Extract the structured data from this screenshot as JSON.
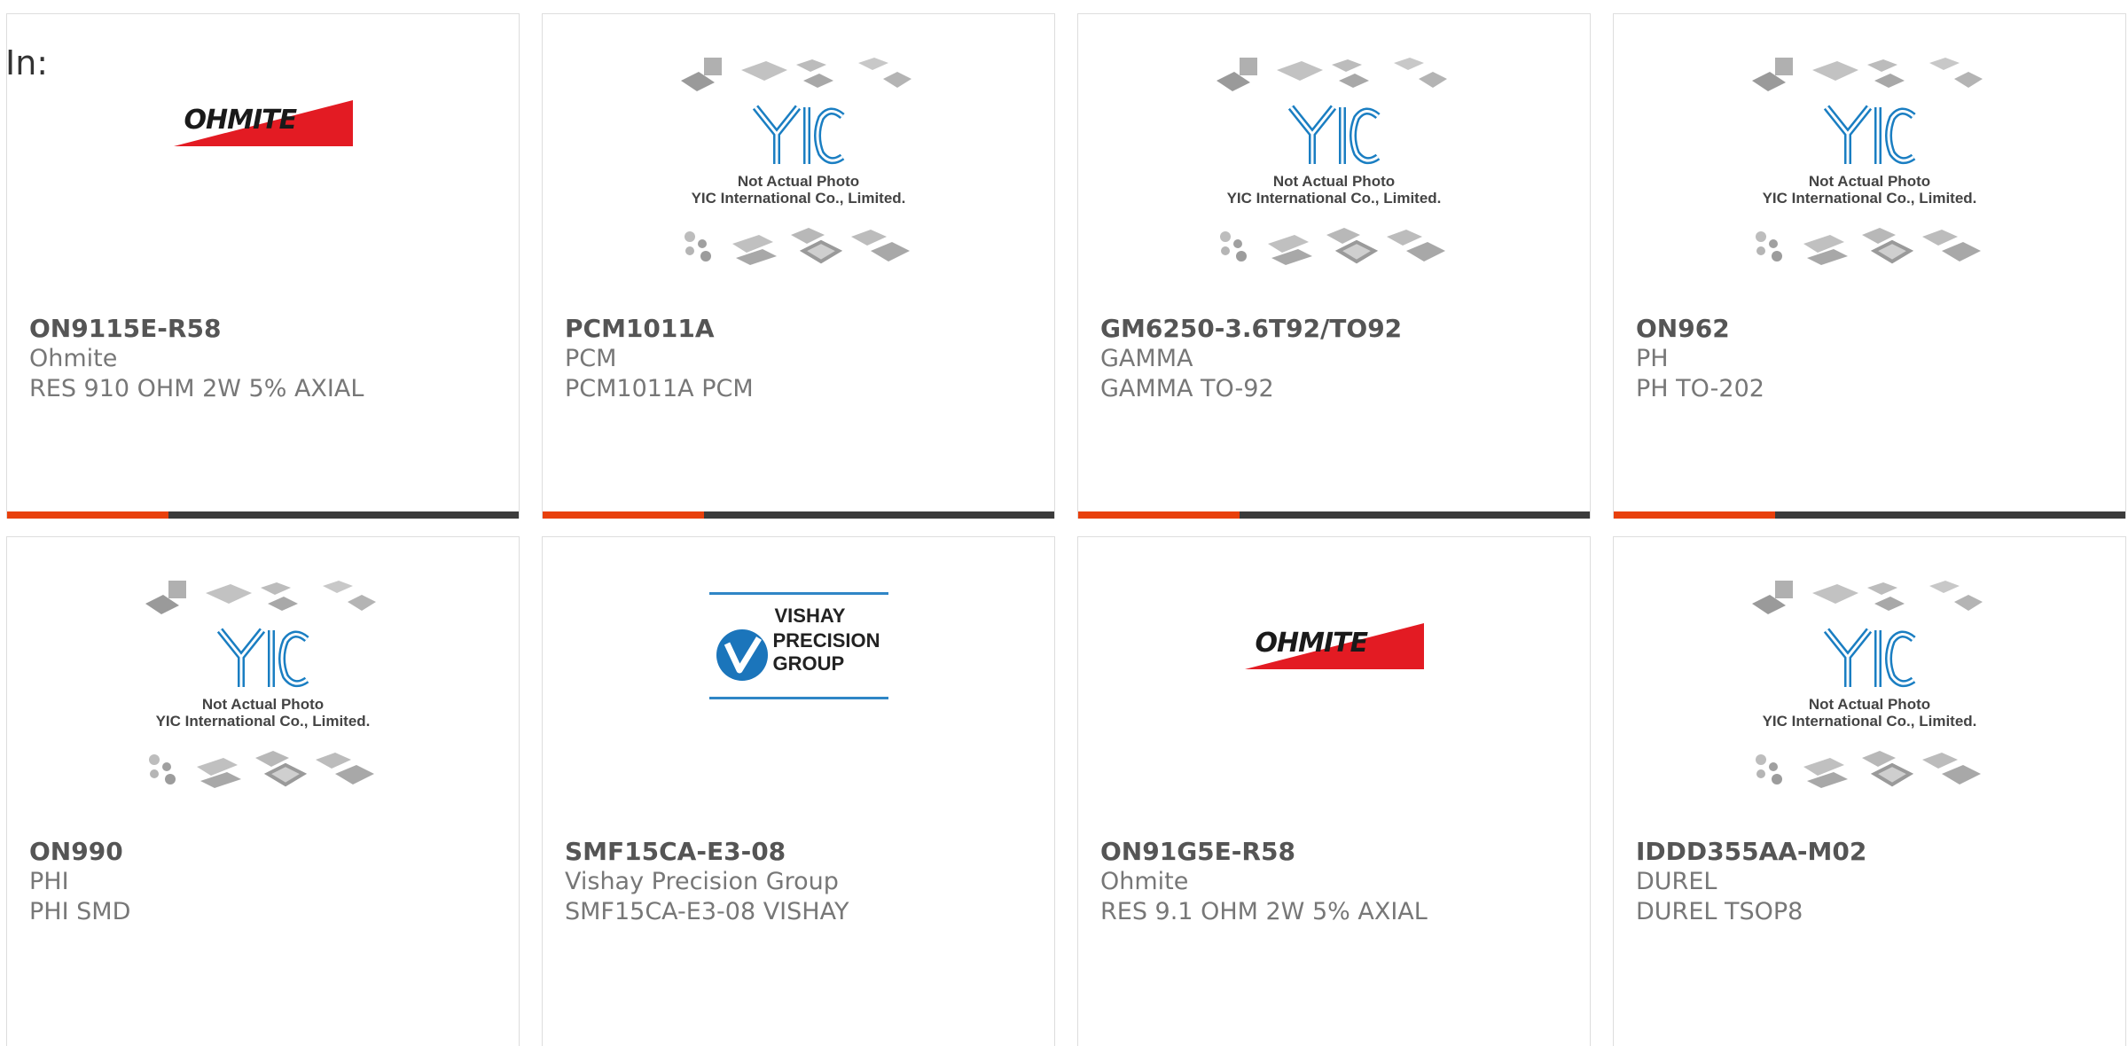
{
  "page": {
    "in_label": "In:"
  },
  "colors": {
    "accent": "#e8400c",
    "bar_dark": "#3b3b3b",
    "ohmite_red": "#e31b23",
    "vishay_blue": "#2f86c6",
    "yic_blue": "#1a7ec2"
  },
  "placeholder": {
    "line1": "Not Actual Photo",
    "line2": "YIC International Co., Limited.",
    "logo_text": "YIC"
  },
  "logos": {
    "ohmite": "OHMITE",
    "vishay": [
      "VISHAY",
      "PRECISION",
      "GROUP"
    ]
  },
  "products": [
    {
      "part": "ON9115E-R58",
      "manufacturer": "Ohmite",
      "description": "RES 910 OHM 2W 5% AXIAL",
      "image": "ohmite-logo"
    },
    {
      "part": "PCM1011A",
      "manufacturer": "PCM",
      "description": "PCM1011A PCM",
      "image": "yic-placeholder"
    },
    {
      "part": "GM6250-3.6T92/TO92",
      "manufacturer": "GAMMA",
      "description": "GAMMA TO-92",
      "image": "yic-placeholder"
    },
    {
      "part": "ON962",
      "manufacturer": "PH",
      "description": "PH TO-202",
      "image": "yic-placeholder"
    },
    {
      "part": "ON990",
      "manufacturer": "PHI",
      "description": "PHI SMD",
      "image": "yic-placeholder"
    },
    {
      "part": "SMF15CA-E3-08",
      "manufacturer": "Vishay Precision Group",
      "description": "SMF15CA-E3-08 VISHAY",
      "image": "vishay-logo"
    },
    {
      "part": "ON91G5E-R58",
      "manufacturer": "Ohmite",
      "description": "RES 9.1 OHM 2W 5% AXIAL",
      "image": "ohmite-logo"
    },
    {
      "part": "IDDD355AA-M02",
      "manufacturer": "DUREL",
      "description": "DUREL TSOP8",
      "image": "yic-placeholder"
    }
  ]
}
